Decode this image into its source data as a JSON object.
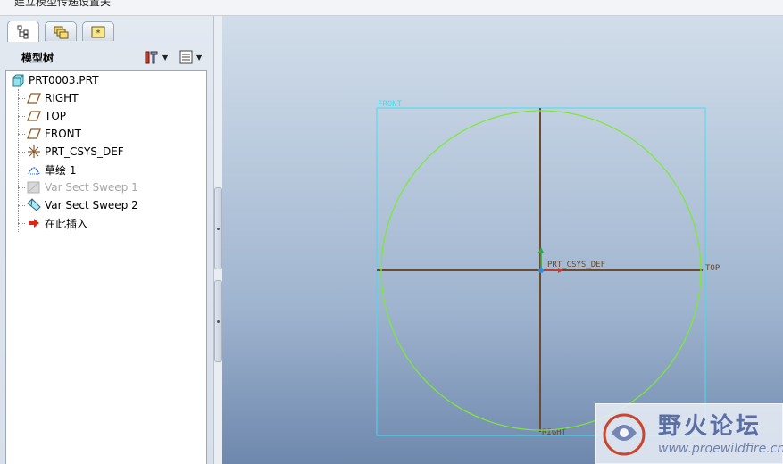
{
  "top_strip": {
    "partial_text": "建立模型传递设置关"
  },
  "left_panel": {
    "tabs": [
      {
        "icon": "model-tree-icon"
      },
      {
        "icon": "layers-icon"
      },
      {
        "icon": "favorites-icon"
      }
    ],
    "tree_title": "模型树",
    "settings_button": {
      "icon": "tree-settings-icon"
    },
    "show_button": {
      "icon": "tree-show-icon"
    },
    "tree": {
      "root": {
        "label": "PRT0003.PRT",
        "icon": "part-icon"
      },
      "items": [
        {
          "label": "RIGHT",
          "icon": "datum-plane-icon",
          "suppressed": false
        },
        {
          "label": "TOP",
          "icon": "datum-plane-icon",
          "suppressed": false
        },
        {
          "label": "FRONT",
          "icon": "datum-plane-icon",
          "suppressed": false
        },
        {
          "label": "PRT_CSYS_DEF",
          "icon": "csys-icon",
          "suppressed": false
        },
        {
          "label": "草绘 1",
          "icon": "sketch-icon",
          "suppressed": false
        },
        {
          "label": "Var Sect Sweep 1",
          "icon": "sweep-icon",
          "suppressed": true
        },
        {
          "label": "Var Sect Sweep 2",
          "icon": "sweep-icon",
          "suppressed": false
        },
        {
          "label": "在此插入",
          "icon": "insert-here-arrow-icon",
          "suppressed": false
        }
      ]
    }
  },
  "graphics": {
    "datum_labels": {
      "front": "FRONT",
      "top": "TOP",
      "right": "RIGHT",
      "csys": "PRT_CSYS_DEF"
    },
    "colors": {
      "datum_frame": "#3fe0ee",
      "circle": "#7de83a",
      "datum_axis": "#6b4a2e",
      "csys_x": "#d43a2a",
      "csys_y": "#2fa84a",
      "csys_z": "#2b8fd8"
    }
  },
  "watermark": {
    "title": "野火论坛",
    "url": "www.proewildfire.cn"
  }
}
